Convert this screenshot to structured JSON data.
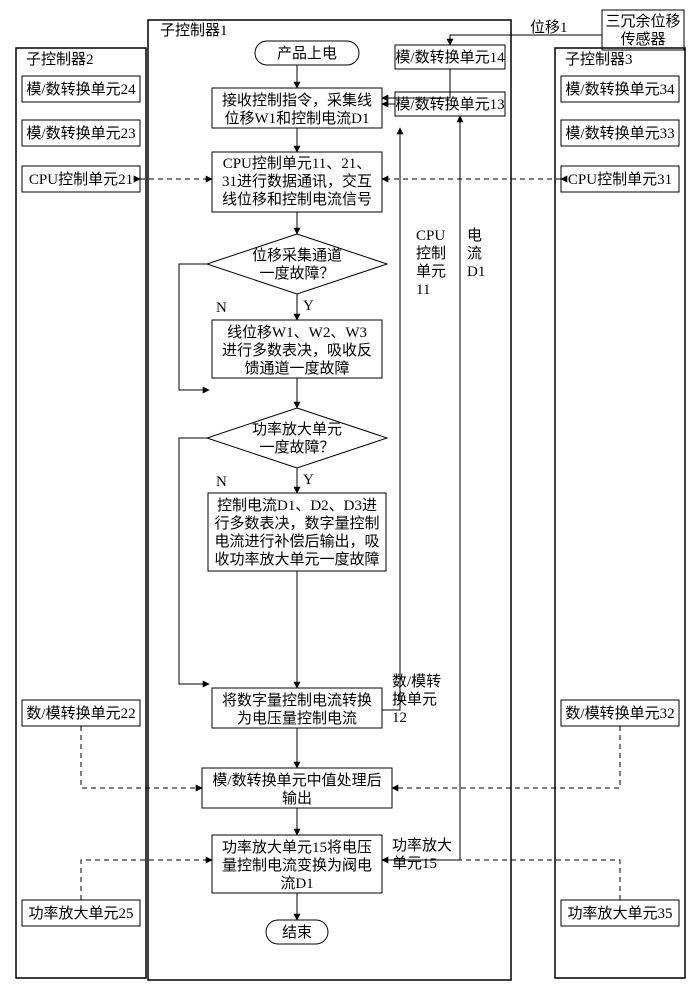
{
  "sensor": {
    "label": "三冗余位移\n传感器",
    "out": "位移1"
  },
  "ctrl1": {
    "title": "子控制器1",
    "nodes": {
      "start": "产品上电",
      "adc14": "模/数转换单元14",
      "adc13": "模/数转换单元13",
      "recv": "接收控制指令，采集线\n位移W1和控制电流D1",
      "comm": "CPU控制单元11、21、\n31进行数据通讯，交互\n线位移和控制电流信号",
      "dec1": "位移采集通道\n一度故障？",
      "vote1": "线位移W1、W2、W3\n进行多数表决，吸收反\n馈通道一度故障",
      "dec2": "功率放大单元\n一度故障？",
      "vote2": "控制电流D1、D2、D3进\n行多数表决，数字量控制\n电流进行补偿后输出，吸\n收功率放大单元一度故障",
      "dac": "将数字量控制电流转换\n为电压量控制电流",
      "median": "模/数转换单元中值处理后\n输出",
      "amp": "功率放大单元15将电压\n量控制电流变换为阀电\n流D1",
      "end": "结束"
    },
    "labels": {
      "y": "Y",
      "n": "N",
      "cpu": "CPU\n控制\n单元\n11",
      "dac": "数/模转\n换单元\n12",
      "amp": "功率放大\n单元15",
      "d1": "电\n流\nD1"
    }
  },
  "ctrl2": {
    "title": "子控制器2",
    "boxes": {
      "adc24": "模/数转换单元24",
      "adc23": "模/数转换单元23",
      "cpu21": "CPU控制单元21",
      "dac22": "数/模转换单元22",
      "amp25": "功率放大单元25"
    }
  },
  "ctrl3": {
    "title": "子控制器3",
    "boxes": {
      "adc34": "模/数转换单元34",
      "adc33": "模/数转换单元33",
      "cpu31": "CPU控制单元31",
      "dac32": "数/模转换单元32",
      "amp35": "功率放大单元35"
    }
  }
}
